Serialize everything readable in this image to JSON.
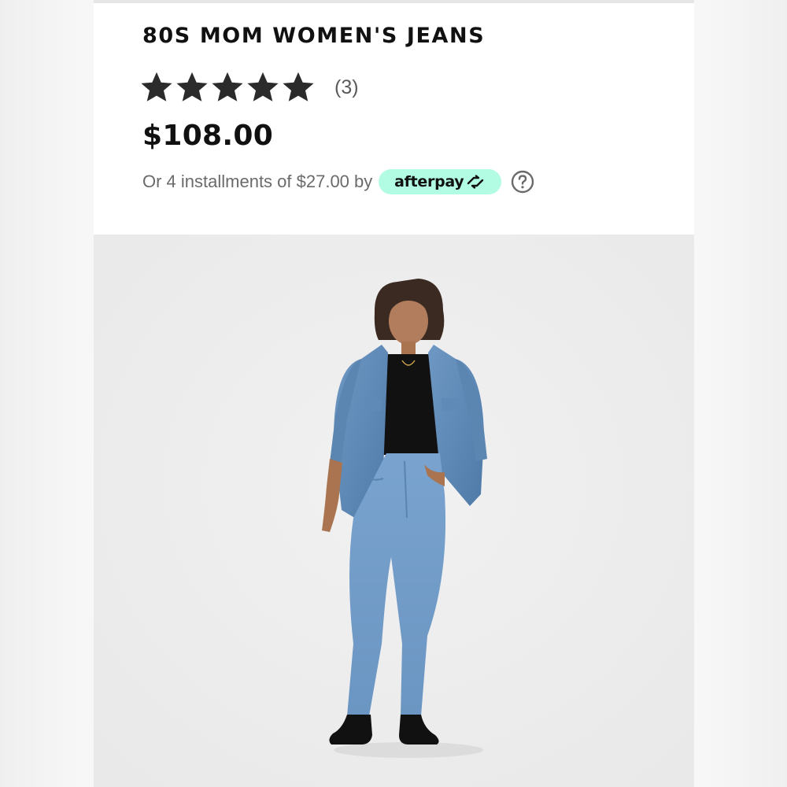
{
  "product": {
    "title": "80S MOM WOMEN'S JEANS",
    "rating": {
      "stars": 5,
      "max_stars": 5,
      "review_count": "(3)"
    },
    "price": "$108.00",
    "installments": {
      "text": "Or 4 installments of $27.00 by",
      "provider": "afterpay",
      "provider_color": "#b2fce4"
    },
    "help_icon": "question-circle-icon",
    "image": {
      "description_icon": "product-photo",
      "denim_color": "#6f98c4",
      "background_color": "#eeeeee"
    }
  }
}
